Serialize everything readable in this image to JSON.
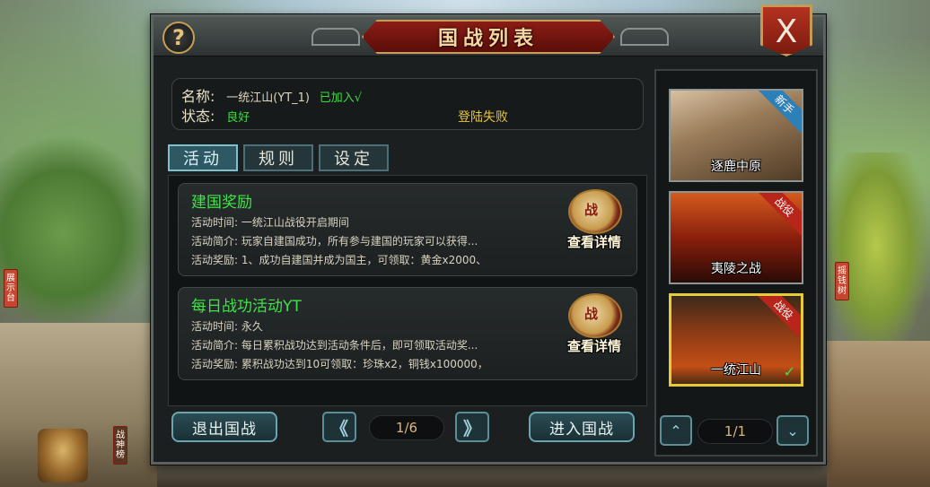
{
  "dialog": {
    "title": "国战列表",
    "help_icon": "?",
    "close_icon": "X"
  },
  "server": {
    "name_label": "名称:",
    "name_value": "一统江山(YT_1)",
    "joined_text": "已加入√",
    "status_label": "状态:",
    "status_value": "良好",
    "login_message": "登陆失败"
  },
  "tabs": [
    {
      "label": "活动",
      "active": true
    },
    {
      "label": "规则",
      "active": false
    },
    {
      "label": "设定",
      "active": false
    }
  ],
  "activities": [
    {
      "title": "建国奖励",
      "lines": [
        "活动时间:  一统江山战役开启期间",
        "活动简介:  玩家自建国成功，所有参与建国的玩家可以获得...",
        "活动奖励:  1、成功自建国并成为国主，可领取：黄金x2000、"
      ],
      "icon_char": "战",
      "detail_label": "查看详情"
    },
    {
      "title": "每日战功活动YT",
      "lines": [
        "活动时间:  永久",
        "活动简介:  每日累积战功达到活动条件后，即可领取活动奖...",
        "活动奖励:  累积战功达到10可领取：珍珠x2，铜钱x100000，"
      ],
      "icon_char": "战",
      "detail_label": "查看详情"
    }
  ],
  "bottom": {
    "exit_label": "退出国战",
    "enter_label": "进入国战",
    "prev_icon": "《",
    "next_icon": "》",
    "page_text": "1/6"
  },
  "battles": [
    {
      "name": "逐鹿中原",
      "tag": "新手",
      "tag_type": "new",
      "selected": false
    },
    {
      "name": "夷陵之战",
      "tag": "战役",
      "tag_type": "war",
      "selected": false
    },
    {
      "name": "一统江山",
      "tag": "战役",
      "tag_type": "war",
      "selected": true,
      "check": "✓"
    }
  ],
  "right_pager": {
    "up_icon": "⌃",
    "down_icon": "⌄",
    "page_text": "1/1"
  },
  "background_signs": [
    "展示台",
    "战神榜",
    "摇钱树"
  ]
}
